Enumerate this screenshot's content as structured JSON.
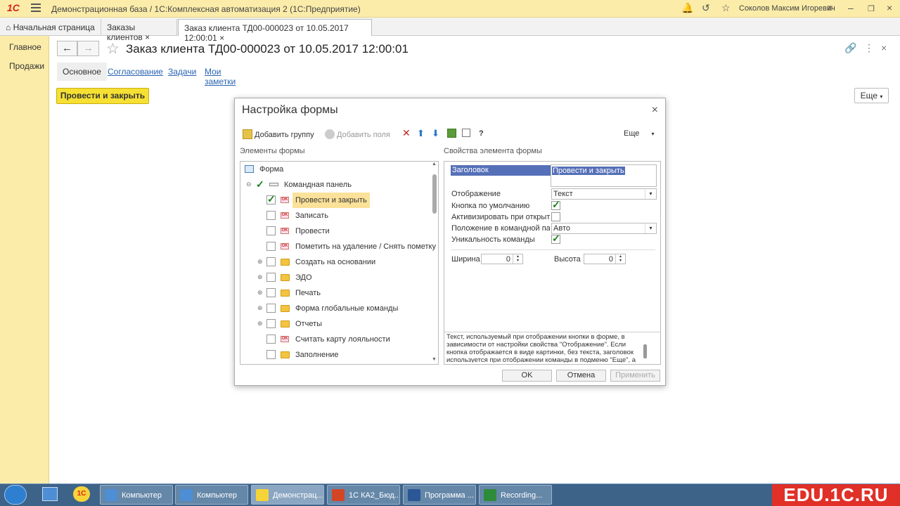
{
  "app": {
    "logo": "1С",
    "title": "Демонстрационная база / 1С:Комплексная автоматизация 2  (1С:Предприятие)",
    "user": "Соколов Максим Игоревич"
  },
  "tabs": [
    {
      "label": "Начальная страница"
    },
    {
      "label": "Заказы клиентов",
      "close": "×"
    },
    {
      "label": "Заказ клиента ТД00-000023 от 10.05.2017 12:00:01",
      "close": "×"
    }
  ],
  "sidebar": {
    "items": [
      "Главное",
      "Продажи"
    ]
  },
  "document": {
    "title": "Заказ клиента ТД00-000023 от 10.05.2017 12:00:01",
    "subtabs": [
      "Основное",
      "Согласование",
      "Задачи",
      "Мои заметки"
    ],
    "post_button": "Провести и закрыть",
    "more_button": "Еще"
  },
  "dialog": {
    "title": "Настройка формы",
    "toolbar": {
      "add_group": "Добавить группу",
      "add_fields": "Добавить поля",
      "help": "?",
      "more": "Еще"
    },
    "left_header": "Элементы формы",
    "right_header": "Свойства элемента формы",
    "tree": [
      {
        "label": "Форма"
      },
      {
        "label": "Командная панель",
        "checked": true
      },
      {
        "label": "Провести и закрыть",
        "checked": true,
        "selected": true
      },
      {
        "label": "Записать",
        "checked": false
      },
      {
        "label": "Провести",
        "checked": false
      },
      {
        "label": "Пометить на удаление / Снять пометку",
        "checked": false
      },
      {
        "label": "Создать на основании",
        "checked": false
      },
      {
        "label": "ЭДО",
        "checked": false
      },
      {
        "label": "Печать",
        "checked": false
      },
      {
        "label": "Форма глобальные команды",
        "checked": false
      },
      {
        "label": "Отчеты",
        "checked": false
      },
      {
        "label": "Считать карту лояльности",
        "checked": false
      },
      {
        "label": "Заполнение",
        "checked": false
      }
    ],
    "props": {
      "title_label": "Заголовок",
      "title_value": "Провести и закрыть",
      "display_label": "Отображение",
      "display_value": "Текст",
      "default_label": "Кнопка по умолчанию",
      "default_checked": true,
      "activate_label": "Активизировать при открытии",
      "activate_checked": false,
      "position_label": "Положение в командной панели",
      "position_value": "Авто",
      "unique_label": "Уникальность команды",
      "unique_checked": true,
      "width_label": "Ширина",
      "width_value": "0",
      "height_label": "Высота",
      "height_value": "0"
    },
    "description": "Текст, используемый при отображении кнопки в форме, в зависимости от настройки свойства \"Отображение\". Если кнопка отображается в виде картинки, без текста, заголовок используется при отображении команды в подменю \"Еще\", а",
    "buttons": {
      "ok": "OK",
      "cancel": "Отмена",
      "apply": "Применить"
    }
  },
  "taskbar": {
    "items": [
      "Компьютер",
      "Компьютер",
      "Демонстрац...",
      "1С КА2_Бюд...",
      "Программа ...",
      "Recording..."
    ],
    "brand": "EDU.1C.RU"
  }
}
